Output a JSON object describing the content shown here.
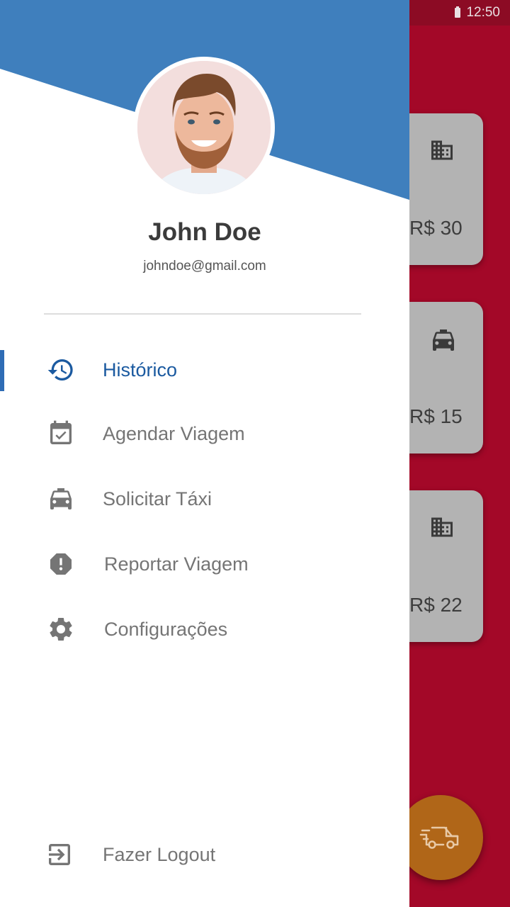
{
  "status_bar": {
    "time": "12:50"
  },
  "trips": [
    {
      "icon": "building-icon",
      "price": "R$ 30"
    },
    {
      "icon": "taxi-icon",
      "price": "R$ 15"
    },
    {
      "icon": "building-icon",
      "price": "R$ 22"
    }
  ],
  "fab": {
    "icon": "delivery-car-icon"
  },
  "drawer": {
    "user": {
      "name": "John Doe",
      "email": "johndoe@gmail.com"
    },
    "menu": [
      {
        "label": "Histórico",
        "icon": "history-icon",
        "active": true
      },
      {
        "label": "Agendar Viagem",
        "icon": "calendar-check-icon",
        "active": false
      },
      {
        "label": "Solicitar Táxi",
        "icon": "taxi-icon",
        "active": false
      },
      {
        "label": "Reportar Viagem",
        "icon": "report-icon",
        "active": false
      },
      {
        "label": "Configurações",
        "icon": "gear-icon",
        "active": false
      }
    ],
    "logout": {
      "label": "Fazer Logout",
      "icon": "logout-icon"
    }
  },
  "colors": {
    "header_blue": "#3f7fbd",
    "accent_blue": "#1b5aa0",
    "background_red": "#a30828",
    "fab_orange": "#b06618",
    "card_gray": "#b3b3b3"
  }
}
